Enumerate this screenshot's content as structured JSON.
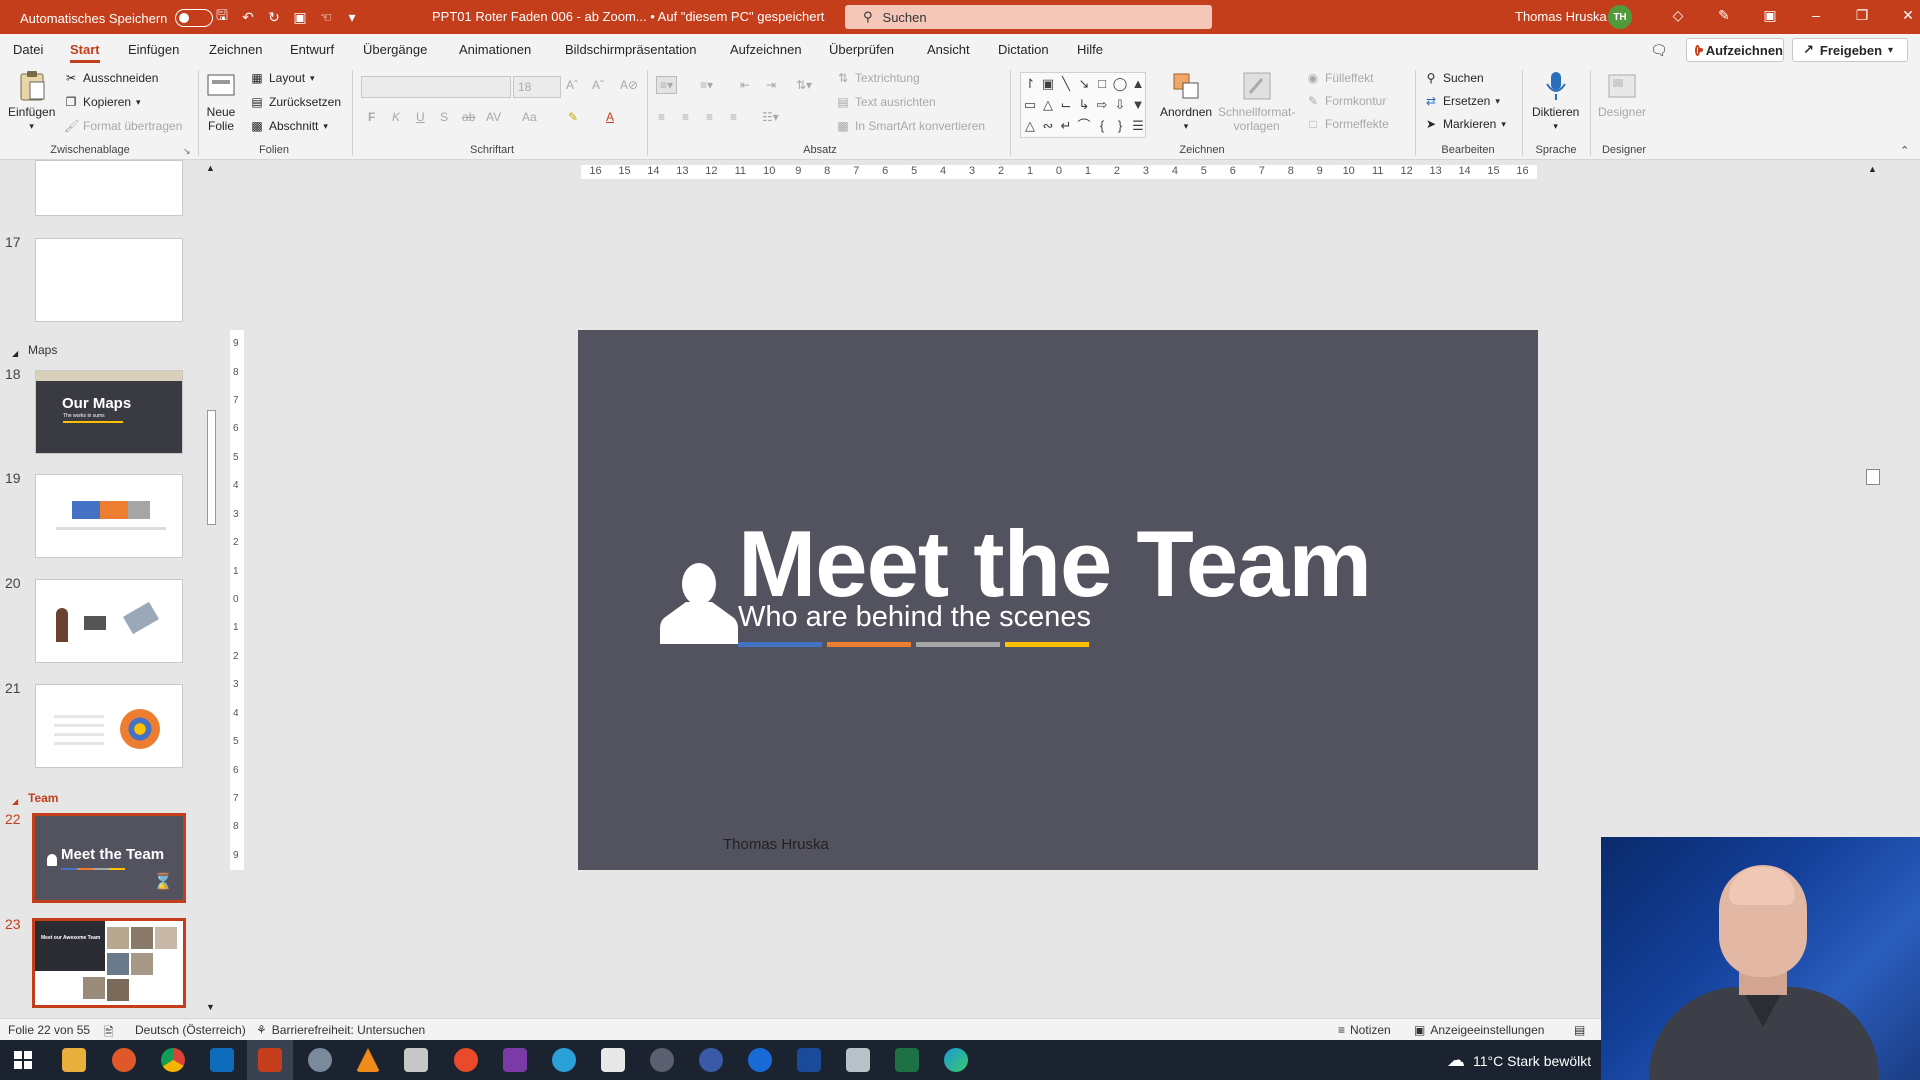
{
  "titlebar": {
    "autosave_label": "Automatisches Speichern",
    "document_title": "PPT01 Roter Faden 006 - ab Zoom... • Auf \"diesem PC\" gespeichert",
    "search_label": "Suchen",
    "user_name": "Thomas Hruska",
    "user_initials": "TH"
  },
  "menu": {
    "tabs": [
      "Datei",
      "Start",
      "Einfügen",
      "Zeichnen",
      "Entwurf",
      "Übergänge",
      "Animationen",
      "Bildschirmpräsentation",
      "Aufzeichnen",
      "Überprüfen",
      "Ansicht",
      "Dictation",
      "Hilfe"
    ],
    "record_label": "Aufzeichnen",
    "share_label": "Freigeben"
  },
  "ribbon": {
    "clipboard": {
      "paste": "Einfügen",
      "cut": "Ausschneiden",
      "copy": "Kopieren",
      "format_painter": "Format übertragen",
      "label": "Zwischenablage"
    },
    "slides": {
      "new_slide_1": "Neue",
      "new_slide_2": "Folie",
      "layout": "Layout",
      "reset": "Zurücksetzen",
      "section": "Abschnitt",
      "label": "Folien"
    },
    "font": {
      "size": "18",
      "bold": "F",
      "italic": "K",
      "underline": "U",
      "shadow": "S",
      "strike": "ab",
      "spacing": "AV",
      "case": "Aa",
      "label": "Schriftart"
    },
    "paragraph": {
      "text_direction": "Textrichtung",
      "align_text": "Text ausrichten",
      "smartart": "In SmartArt konvertieren",
      "label": "Absatz"
    },
    "drawing": {
      "arrange": "Anordnen",
      "quick_styles_1": "Schnellformat-",
      "quick_styles_2": "vorlagen",
      "fill": "Fülleffekt",
      "outline": "Formkontur",
      "effects": "Formeffekte",
      "label": "Zeichnen"
    },
    "editing": {
      "find": "Suchen",
      "replace": "Ersetzen",
      "select": "Markieren",
      "label": "Bearbeiten"
    },
    "voice": {
      "dictate": "Diktieren",
      "label": "Sprache"
    },
    "designer": {
      "designer": "Designer",
      "label": "Designer"
    }
  },
  "thumbnails": {
    "num_17": "17",
    "section_maps": "Maps",
    "num_18": "18",
    "thumb_18_title": "Our Maps",
    "thumb_18_sub": "The works in sums",
    "num_19": "19",
    "num_20": "20",
    "num_21": "21",
    "section_team": "Team",
    "num_22": "22",
    "thumb_22_title": "Meet the Team",
    "num_23": "23",
    "thumb_23_title": "Meet our Awesome Team"
  },
  "slide": {
    "title": "Meet the Team",
    "subtitle": "Who are behind the scenes",
    "author": "Thomas Hruska",
    "bar_colors": [
      "#4472c4",
      "#ed7d31",
      "#a5a5a5",
      "#ffc000"
    ],
    "background": "#52535e"
  },
  "ruler": {
    "horizontal": [
      "16",
      "15",
      "14",
      "13",
      "12",
      "11",
      "10",
      "9",
      "8",
      "7",
      "6",
      "5",
      "4",
      "3",
      "2",
      "1",
      "0",
      "1",
      "2",
      "3",
      "4",
      "5",
      "6",
      "7",
      "8",
      "9",
      "10",
      "11",
      "12",
      "13",
      "14",
      "15",
      "16"
    ],
    "vertical": [
      "9",
      "8",
      "7",
      "6",
      "5",
      "4",
      "3",
      "2",
      "1",
      "0",
      "1",
      "2",
      "3",
      "4",
      "5",
      "6",
      "7",
      "8",
      "9"
    ]
  },
  "status": {
    "slide_of": "Folie 22 von 55",
    "language": "Deutsch (Österreich)",
    "accessibility": "Barrierefreiheit: Untersuchen",
    "notes": "Notizen",
    "display_settings": "Anzeigeeinstellungen"
  },
  "taskbar": {
    "weather": "11°C  Stark bewölkt"
  },
  "colors": {
    "accent": "#c43e1c",
    "titlebar": "#c43e1c",
    "taskbar": "#1c2330"
  }
}
